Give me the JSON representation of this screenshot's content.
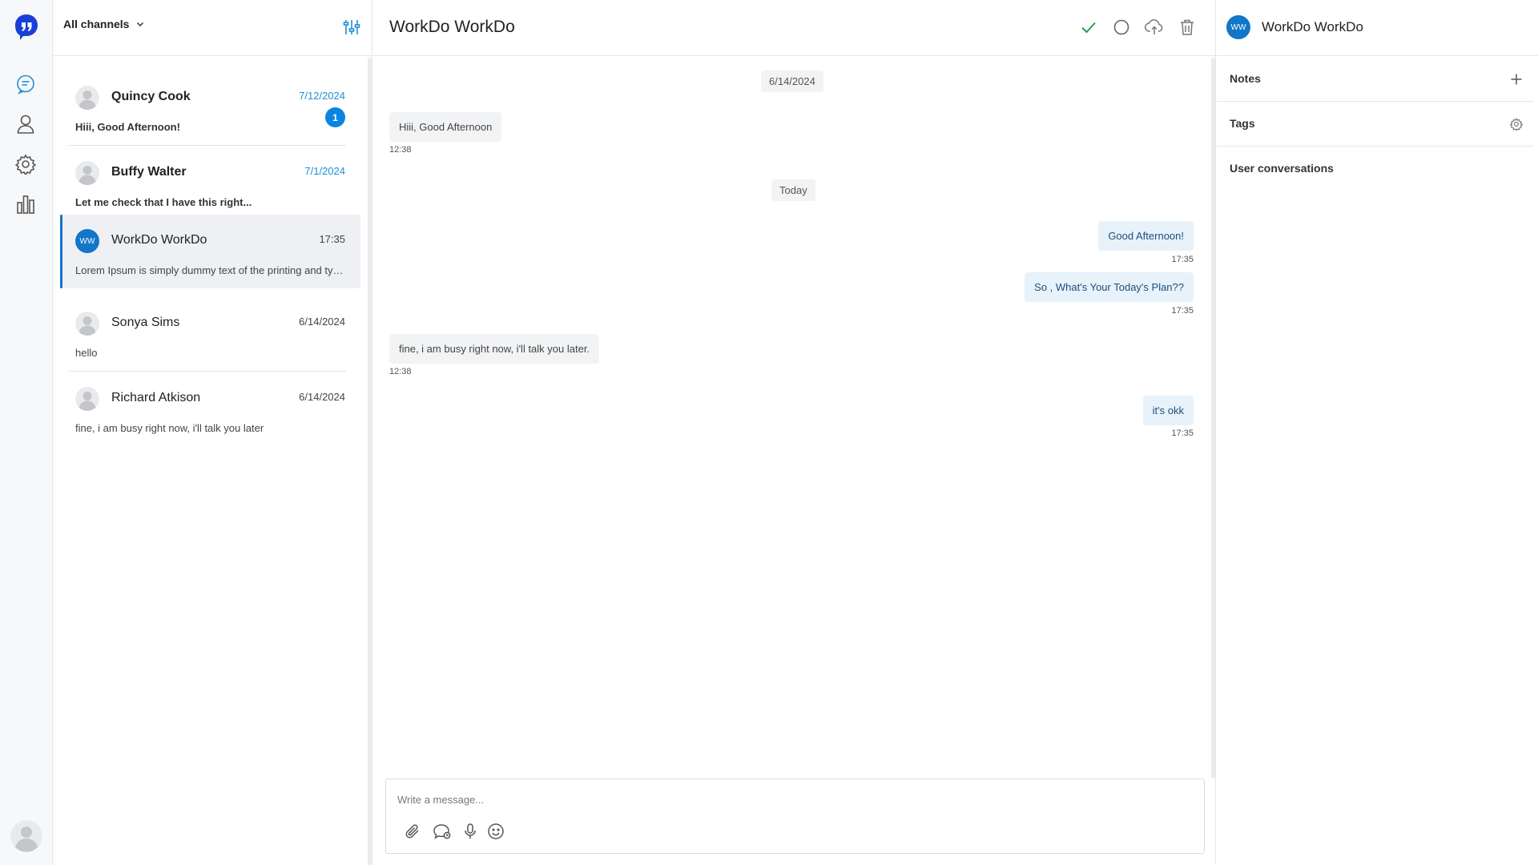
{
  "rail": {
    "icons": [
      "logo-icon",
      "chat-icon",
      "user-icon",
      "gear-icon",
      "bar-chart-icon",
      "profile-avatar"
    ],
    "accent": "#1a3fd8"
  },
  "list": {
    "channel_filter": "All channels",
    "conversations": [
      {
        "name": "Quincy Cook",
        "time": "7/12/2024",
        "preview": "Hiii, Good Afternoon!",
        "unread": "1"
      },
      {
        "name": "Buffy Walter",
        "time": "7/1/2024",
        "preview": "Let me check that I have this right..."
      },
      {
        "name": "WorkDo WorkDo",
        "initials": "WW",
        "time": "17:35",
        "preview": "Lorem Ipsum is simply dummy text of the printing and typesetting industry."
      },
      {
        "name": "Sonya Sims",
        "time": "6/14/2024",
        "preview": "hello"
      },
      {
        "name": "Richard Atkison",
        "time": "6/14/2024",
        "preview": "fine, i am busy right now, i'll talk you later"
      }
    ]
  },
  "chat": {
    "title": "WorkDo WorkDo",
    "header_actions": [
      "check-icon",
      "circle-icon",
      "cloud-upload-icon",
      "trash-icon"
    ],
    "messages": [
      {
        "type": "date",
        "text": "6/14/2024"
      },
      {
        "type": "in",
        "text": "Hiii, Good Afternoon",
        "time": "12:38"
      },
      {
        "type": "date",
        "text": "Today"
      },
      {
        "type": "out",
        "text": "Good Afternoon!",
        "time": "17:35"
      },
      {
        "type": "out",
        "text": "So , What's Your Today's Plan??",
        "time": "17:35"
      },
      {
        "type": "in",
        "text": "fine, i am busy right now, i'll talk you later.",
        "time": "12:38"
      },
      {
        "type": "out",
        "text": "it's okk",
        "time": "17:35"
      }
    ],
    "composer": {
      "placeholder": "Write a message...",
      "actions": [
        "paperclip-icon",
        "chat-bubble-icon",
        "microphone-icon",
        "emoji-icon"
      ]
    }
  },
  "info": {
    "initials": "WW",
    "name": "WorkDo WorkDo",
    "sections": [
      {
        "label": "Notes",
        "action": "plus-icon"
      },
      {
        "label": "Tags",
        "action": "gear-icon"
      },
      {
        "label": "User conversations"
      }
    ]
  },
  "colors": {
    "accent_blue": "#1276c9",
    "badge_blue": "#0a84e0",
    "outgoing_bubble": "#e7f2fb",
    "incoming_bubble": "#f2f3f5",
    "check_green": "#2a9d57"
  }
}
